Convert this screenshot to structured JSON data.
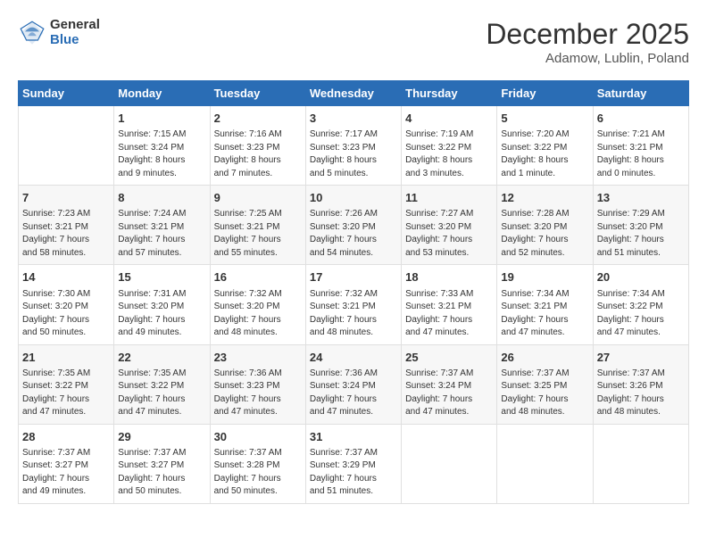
{
  "header": {
    "logo_general": "General",
    "logo_blue": "Blue",
    "month_title": "December 2025",
    "location": "Adamow, Lublin, Poland"
  },
  "days_of_week": [
    "Sunday",
    "Monday",
    "Tuesday",
    "Wednesday",
    "Thursday",
    "Friday",
    "Saturday"
  ],
  "weeks": [
    [
      {
        "num": "",
        "info": ""
      },
      {
        "num": "1",
        "info": "Sunrise: 7:15 AM\nSunset: 3:24 PM\nDaylight: 8 hours\nand 9 minutes."
      },
      {
        "num": "2",
        "info": "Sunrise: 7:16 AM\nSunset: 3:23 PM\nDaylight: 8 hours\nand 7 minutes."
      },
      {
        "num": "3",
        "info": "Sunrise: 7:17 AM\nSunset: 3:23 PM\nDaylight: 8 hours\nand 5 minutes."
      },
      {
        "num": "4",
        "info": "Sunrise: 7:19 AM\nSunset: 3:22 PM\nDaylight: 8 hours\nand 3 minutes."
      },
      {
        "num": "5",
        "info": "Sunrise: 7:20 AM\nSunset: 3:22 PM\nDaylight: 8 hours\nand 1 minute."
      },
      {
        "num": "6",
        "info": "Sunrise: 7:21 AM\nSunset: 3:21 PM\nDaylight: 8 hours\nand 0 minutes."
      }
    ],
    [
      {
        "num": "7",
        "info": "Sunrise: 7:23 AM\nSunset: 3:21 PM\nDaylight: 7 hours\nand 58 minutes."
      },
      {
        "num": "8",
        "info": "Sunrise: 7:24 AM\nSunset: 3:21 PM\nDaylight: 7 hours\nand 57 minutes."
      },
      {
        "num": "9",
        "info": "Sunrise: 7:25 AM\nSunset: 3:21 PM\nDaylight: 7 hours\nand 55 minutes."
      },
      {
        "num": "10",
        "info": "Sunrise: 7:26 AM\nSunset: 3:20 PM\nDaylight: 7 hours\nand 54 minutes."
      },
      {
        "num": "11",
        "info": "Sunrise: 7:27 AM\nSunset: 3:20 PM\nDaylight: 7 hours\nand 53 minutes."
      },
      {
        "num": "12",
        "info": "Sunrise: 7:28 AM\nSunset: 3:20 PM\nDaylight: 7 hours\nand 52 minutes."
      },
      {
        "num": "13",
        "info": "Sunrise: 7:29 AM\nSunset: 3:20 PM\nDaylight: 7 hours\nand 51 minutes."
      }
    ],
    [
      {
        "num": "14",
        "info": "Sunrise: 7:30 AM\nSunset: 3:20 PM\nDaylight: 7 hours\nand 50 minutes."
      },
      {
        "num": "15",
        "info": "Sunrise: 7:31 AM\nSunset: 3:20 PM\nDaylight: 7 hours\nand 49 minutes."
      },
      {
        "num": "16",
        "info": "Sunrise: 7:32 AM\nSunset: 3:20 PM\nDaylight: 7 hours\nand 48 minutes."
      },
      {
        "num": "17",
        "info": "Sunrise: 7:32 AM\nSunset: 3:21 PM\nDaylight: 7 hours\nand 48 minutes."
      },
      {
        "num": "18",
        "info": "Sunrise: 7:33 AM\nSunset: 3:21 PM\nDaylight: 7 hours\nand 47 minutes."
      },
      {
        "num": "19",
        "info": "Sunrise: 7:34 AM\nSunset: 3:21 PM\nDaylight: 7 hours\nand 47 minutes."
      },
      {
        "num": "20",
        "info": "Sunrise: 7:34 AM\nSunset: 3:22 PM\nDaylight: 7 hours\nand 47 minutes."
      }
    ],
    [
      {
        "num": "21",
        "info": "Sunrise: 7:35 AM\nSunset: 3:22 PM\nDaylight: 7 hours\nand 47 minutes."
      },
      {
        "num": "22",
        "info": "Sunrise: 7:35 AM\nSunset: 3:22 PM\nDaylight: 7 hours\nand 47 minutes."
      },
      {
        "num": "23",
        "info": "Sunrise: 7:36 AM\nSunset: 3:23 PM\nDaylight: 7 hours\nand 47 minutes."
      },
      {
        "num": "24",
        "info": "Sunrise: 7:36 AM\nSunset: 3:24 PM\nDaylight: 7 hours\nand 47 minutes."
      },
      {
        "num": "25",
        "info": "Sunrise: 7:37 AM\nSunset: 3:24 PM\nDaylight: 7 hours\nand 47 minutes."
      },
      {
        "num": "26",
        "info": "Sunrise: 7:37 AM\nSunset: 3:25 PM\nDaylight: 7 hours\nand 48 minutes."
      },
      {
        "num": "27",
        "info": "Sunrise: 7:37 AM\nSunset: 3:26 PM\nDaylight: 7 hours\nand 48 minutes."
      }
    ],
    [
      {
        "num": "28",
        "info": "Sunrise: 7:37 AM\nSunset: 3:27 PM\nDaylight: 7 hours\nand 49 minutes."
      },
      {
        "num": "29",
        "info": "Sunrise: 7:37 AM\nSunset: 3:27 PM\nDaylight: 7 hours\nand 50 minutes."
      },
      {
        "num": "30",
        "info": "Sunrise: 7:37 AM\nSunset: 3:28 PM\nDaylight: 7 hours\nand 50 minutes."
      },
      {
        "num": "31",
        "info": "Sunrise: 7:37 AM\nSunset: 3:29 PM\nDaylight: 7 hours\nand 51 minutes."
      },
      {
        "num": "",
        "info": ""
      },
      {
        "num": "",
        "info": ""
      },
      {
        "num": "",
        "info": ""
      }
    ]
  ]
}
